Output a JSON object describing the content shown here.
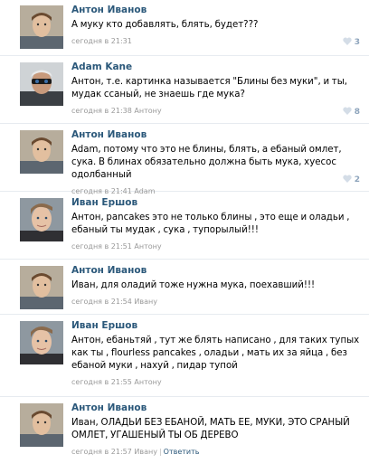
{
  "colors": {
    "author_link": "#2b587a",
    "meta_text": "#999999",
    "like_heart": "#d4dde7",
    "like_count": "#8da4bc",
    "divider": "#e7ebf0"
  },
  "comments": [
    {
      "author": "Антон Иванов",
      "text": "А муку кто добавлять, блять, будет???",
      "time": "сегодня в 21:31",
      "likes": "3"
    },
    {
      "author": "Adam Kane",
      "text": "Антон, т.е. картинка называется \"Блины без муки\", и ты, мудак ссаный, не знаешь где мука?",
      "time": "сегодня в 21:38 Антону",
      "likes": "8"
    },
    {
      "author": "Антон Иванов",
      "text": "Adam, потому что это не блины, блять, а ебаный омлет, сука. В блинах обязательно должна быть мука, хуесос одолбанный",
      "time": "сегодня в 21:41 Adam",
      "likes": "2"
    },
    {
      "author": "Иван Ершов",
      "text": "Антон, pancakes это не только блины , это еще и оладьи , ебаный ты мудак , сука , тупорылый!!!",
      "time": "сегодня в 21:51 Антону"
    },
    {
      "author": "Антон Иванов",
      "text": "Иван, для оладий тоже нужна мука, поехавший!!!",
      "time": "сегодня в 21:54 Ивану"
    },
    {
      "author": "Иван Ершов",
      "text": "Антон, ебаньтяй , тут же блять написано , для таких тупых как ты , flourless pancakes , оладьи , мать их за яйца , без ебаной муки , нахуй , пидар тупой",
      "time": "сегодня в 21:55 Антону"
    },
    {
      "author": "Антон Иванов",
      "text": "Иван, ОЛАДЬИ БЕЗ ЕБАНОЙ, МАТЬ ЕЕ, МУКИ, ЭТО СРАНЫЙ ОМЛЕТ, УГАШЕНЫЙ ТЫ ОБ ДЕРЕВО",
      "time": "сегодня в 21:57 Ивану",
      "reply": "Ответить"
    }
  ]
}
